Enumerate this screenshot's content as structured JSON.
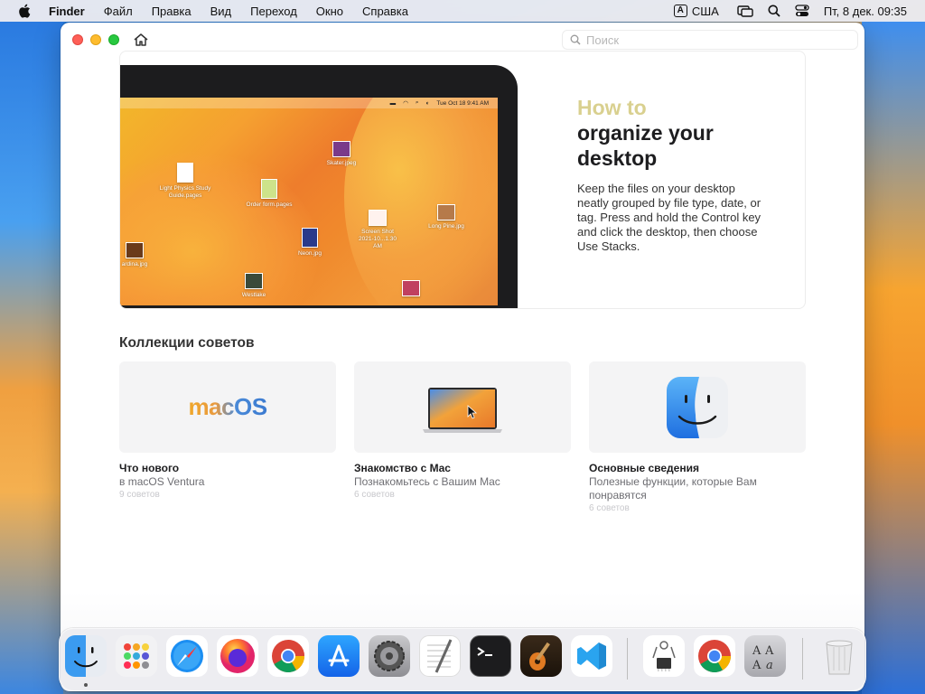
{
  "menubar": {
    "app_name": "Finder",
    "items": [
      "Файл",
      "Правка",
      "Вид",
      "Переход",
      "Окно",
      "Справка"
    ],
    "input_badge": "A",
    "input_source": "США",
    "clock": "Пт, 8 дек.  09:35"
  },
  "window": {
    "search_placeholder": "Поиск"
  },
  "hero": {
    "eyebrow": "How to",
    "title": "organize your desktop",
    "body": "Keep the files on your desktop neatly grouped by file type, date, or tag. Press and hold the Control key and click the desktop, then choose Use Stacks.",
    "mini_clock": "Tue Oct 18  9:41 AM",
    "files": [
      {
        "name": "Light Physics Study Guide.pages"
      },
      {
        "name": "Order form.pages"
      },
      {
        "name": "Skater.jpeg"
      },
      {
        "name": "Screen Shot 2021-10...1.30 AM"
      },
      {
        "name": "Long Pine.jpg"
      },
      {
        "name": "Neon.jpg"
      },
      {
        "name": "ardina.jpg"
      },
      {
        "name": "Westlake"
      }
    ]
  },
  "collections": {
    "title": "Коллекции советов",
    "cards": [
      {
        "logo": "macOS",
        "title": "Что нового",
        "subtitle": "в macOS Ventura",
        "count": "9 советов"
      },
      {
        "title": "Знакомство с Mac",
        "subtitle": "Познакомьтесь с Вашим Mac",
        "count": "6 советов"
      },
      {
        "title": "Основные сведения",
        "subtitle": "Полезные функции, которые Вам понравятся",
        "count": "6 советов"
      }
    ]
  },
  "dock": {
    "apps": [
      "finder-icon",
      "launchpad-icon",
      "safari-icon",
      "firefox-icon",
      "chrome-icon",
      "app-store-icon",
      "system-settings-icon",
      "textedit-icon",
      "terminal-icon",
      "garageband-icon",
      "vscode-icon",
      "system-information-icon",
      "chrome-icon",
      "font-book-icon",
      "trash-icon"
    ]
  },
  "colors": {
    "accent_yellow": "#d9d08f",
    "macos_orange": "#f0a82a",
    "macos_blue": "#3b7ad0"
  }
}
